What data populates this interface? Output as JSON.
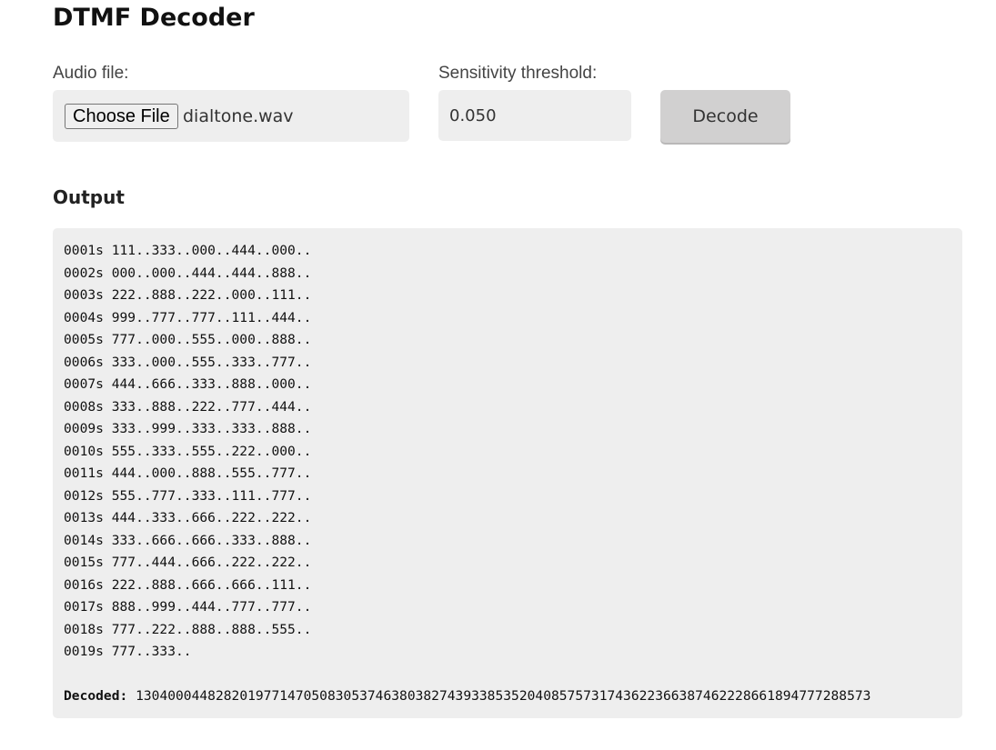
{
  "page": {
    "title": "DTMF Decoder"
  },
  "form": {
    "audio_label": "Audio file:",
    "choose_button": "Choose File",
    "file_name": "dialtone.wav",
    "sensitivity_label": "Sensitivity threshold:",
    "sensitivity_value": "0.050",
    "decode_button": "Decode"
  },
  "output": {
    "title": "Output",
    "lines": [
      "0001s 111..333..000..444..000..",
      "0002s 000..000..444..444..888..",
      "0003s 222..888..222..000..111..",
      "0004s 999..777..777..111..444..",
      "0005s 777..000..555..000..888..",
      "0006s 333..000..555..333..777..",
      "0007s 444..666..333..888..000..",
      "0008s 333..888..222..777..444..",
      "0009s 333..999..333..333..888..",
      "0010s 555..333..555..222..000..",
      "0011s 444..000..888..555..777..",
      "0012s 555..777..333..111..777..",
      "0013s 444..333..666..222..222..",
      "0014s 333..666..666..333..888..",
      "0015s 777..444..666..222..222..",
      "0016s 222..888..666..666..111..",
      "0017s 888..999..444..777..777..",
      "0018s 777..222..888..888..555..",
      "0019s 777..333.."
    ],
    "decoded_label": "Decoded:",
    "decoded_value": "13040004482820197714705083053746380382743933853520408575731743622366387462228661894777288573"
  }
}
